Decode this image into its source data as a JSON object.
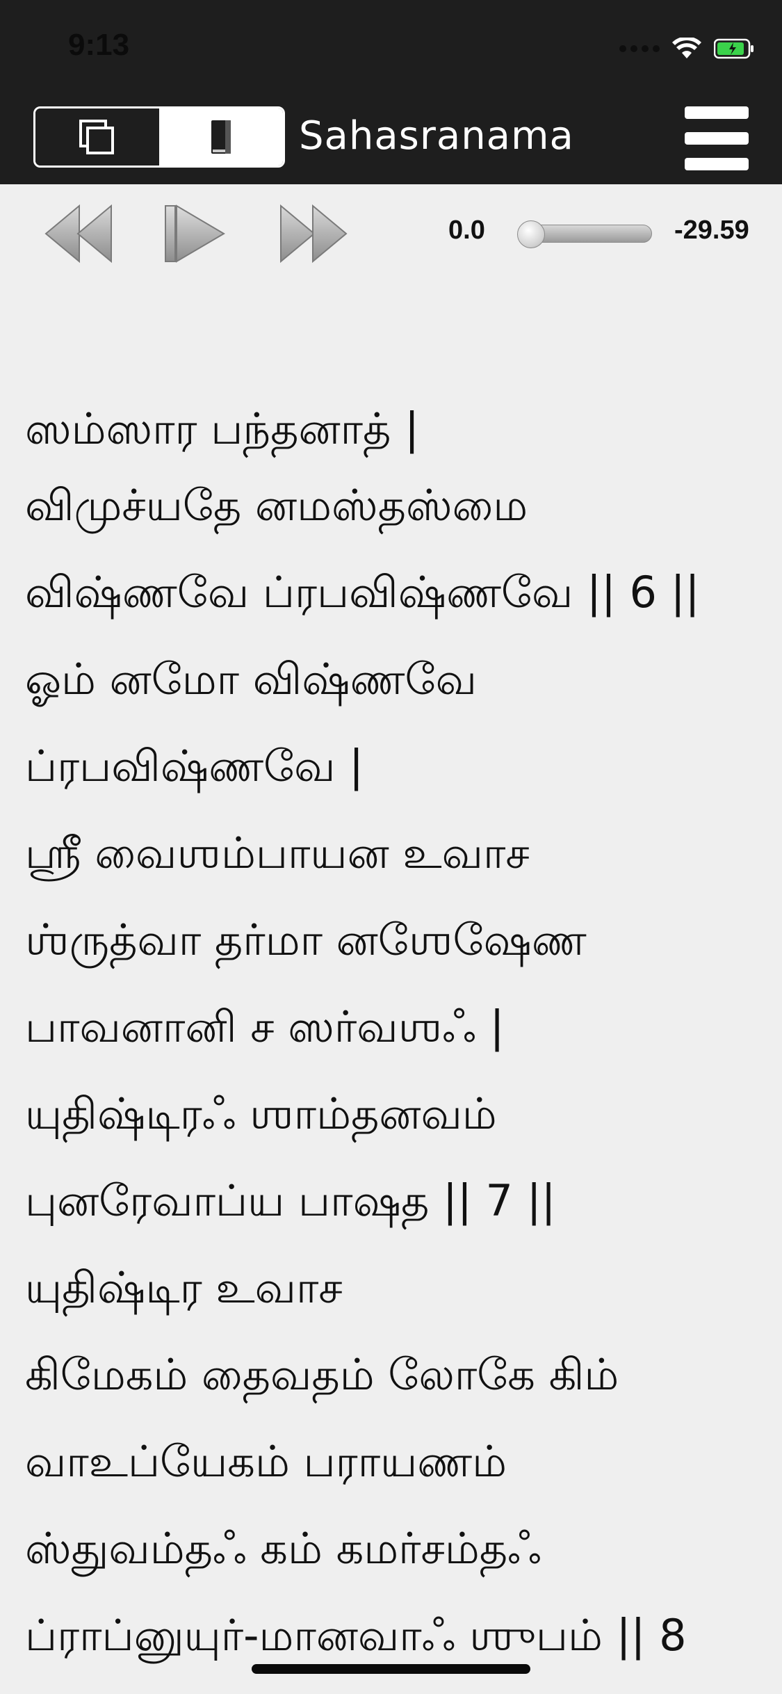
{
  "status_bar": {
    "time": "9:13"
  },
  "nav": {
    "title": "Sahasranama",
    "segments": [
      "copy-icon",
      "book-icon"
    ],
    "menu_icon": "hamburger-menu-icon"
  },
  "player": {
    "elapsed": "0.0",
    "remaining": "-29.59",
    "progress": 0.0
  },
  "verse": {
    "lines": [
      "ஸம்ஸார பந்தனாத் |",
      "விமுச்யதே னமஸ்தஸ்மை",
      "விஷ்ணவே ப்ரபவிஷ்ணவே || 6 ||",
      "ஓம் னமோ விஷ்ணவே",
      "ப்ரபவிஷ்ணவே |",
      "ஶ்ரீ வைஶம்பாயன உவாச",
      "ஶ்ருத்வா தர்மா னஶேஷேண",
      "பாவனானி ச ஸர்வஶஃ |",
      "யுதிஷ்டிரஃ ஶாம்தனவம்",
      "புனரேவாப்ய பாஷத || 7 ||",
      "யுதிஷ்டிர உவாச",
      "கிமேகம் தைவதம் லோகே கிம்",
      "வாஉப்யேகம் பராயணம்",
      "ஸ்துவம்தஃ கம் கமர்சம்தஃ",
      "ப்ராப்னுயுர்-மானவாஃ ஶுபம் || 8"
    ]
  }
}
